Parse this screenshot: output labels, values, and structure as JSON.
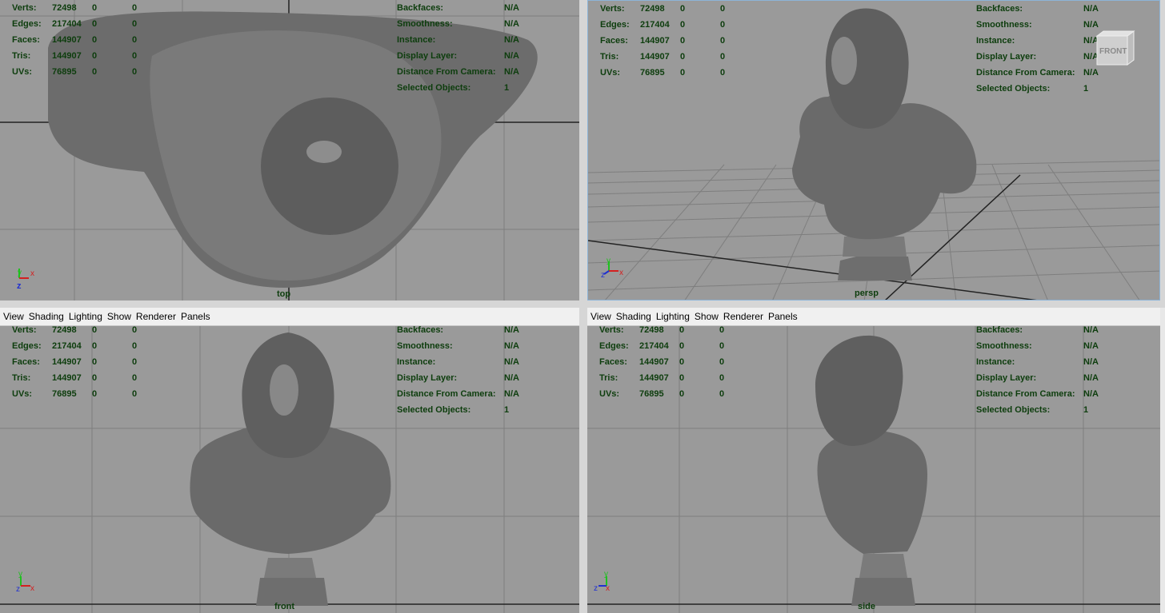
{
  "menu": [
    "View",
    "Shading",
    "Lighting",
    "Show",
    "Renderer",
    "Panels"
  ],
  "stats_left": [
    {
      "label": "Verts:",
      "v1": "72498",
      "v2": "0",
      "v3": "0"
    },
    {
      "label": "Edges:",
      "v1": "217404",
      "v2": "0",
      "v3": "0"
    },
    {
      "label": "Faces:",
      "v1": "144907",
      "v2": "0",
      "v3": "0"
    },
    {
      "label": "Tris:",
      "v1": "144907",
      "v2": "0",
      "v3": "0"
    },
    {
      "label": "UVs:",
      "v1": "76895",
      "v2": "0",
      "v3": "0"
    }
  ],
  "stats_right": [
    {
      "label": "Backfaces:",
      "value": "N/A"
    },
    {
      "label": "Smoothness:",
      "value": "N/A"
    },
    {
      "label": "Instance:",
      "value": "N/A"
    },
    {
      "label": "Display Layer:",
      "value": "N/A"
    },
    {
      "label": "Distance From Camera:",
      "value": "N/A"
    },
    {
      "label": "Selected Objects:",
      "value": "1"
    }
  ],
  "viewports": {
    "top": {
      "camera": "top"
    },
    "persp": {
      "camera": "persp",
      "viewcube": "FRONT"
    },
    "front": {
      "camera": "front"
    },
    "side": {
      "camera": "side"
    }
  },
  "colors": {
    "viewport_bg": "#9a9a9a",
    "hud_text": "#0d3d0d",
    "axis_x": "#d42020",
    "axis_y": "#20c020",
    "axis_z": "#2030d0"
  },
  "icons": [
    "axis-gizmo-icon",
    "viewcube-icon"
  ]
}
